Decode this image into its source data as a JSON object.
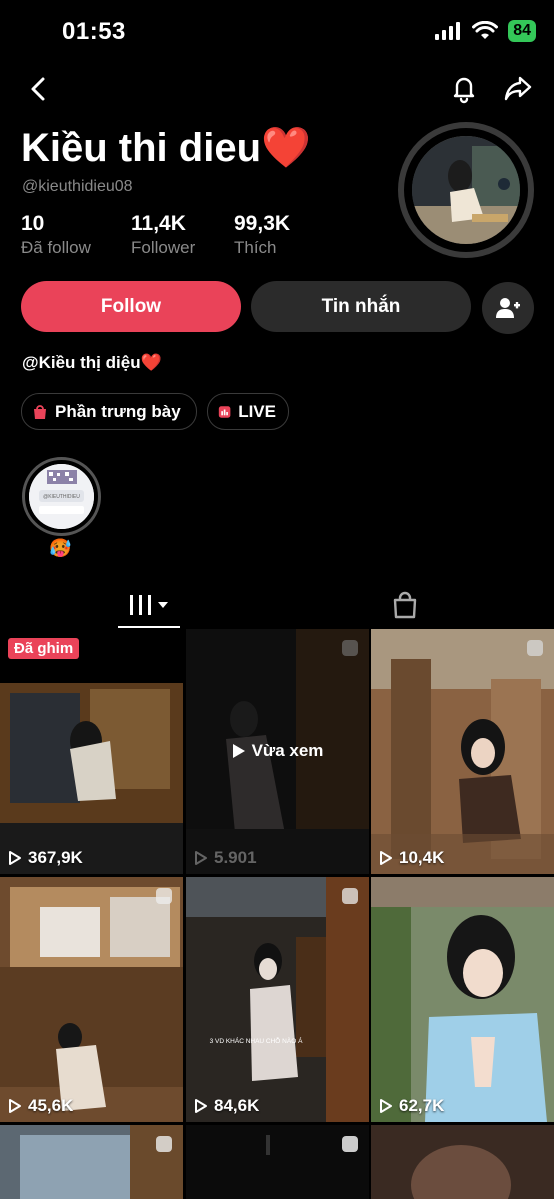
{
  "status_bar": {
    "time": "01:53",
    "battery": "84"
  },
  "profile": {
    "display_name": "Kiều thi dieu❤️",
    "username": "@kieuthidieu08",
    "stats": [
      {
        "value": "10",
        "label": "Đã follow"
      },
      {
        "value": "11,4K",
        "label": "Follower"
      },
      {
        "value": "99,3K",
        "label": "Thích"
      }
    ],
    "bio": "@Kiều thị diệu❤️"
  },
  "actions": {
    "follow": "Follow",
    "message": "Tin nhắn"
  },
  "chips": {
    "showcase": "Phần trưng bày",
    "live": "LIVE"
  },
  "highlight": {
    "label": "🥵",
    "qr_caption": "@KIEUTHIDIEU"
  },
  "videos": [
    {
      "views": "367,9K",
      "badge": "Đã ghim"
    },
    {
      "views": "5.901",
      "overlay": "Vừa xem"
    },
    {
      "views": "10,4K"
    },
    {
      "views": "45,6K"
    },
    {
      "views": "84,6K",
      "caption": "3 VD KHÁC NHAU CHỖ NÀO Á"
    },
    {
      "views": "62,7K"
    }
  ],
  "colors": {
    "accent": "#ea4359",
    "battery": "#34c759"
  }
}
